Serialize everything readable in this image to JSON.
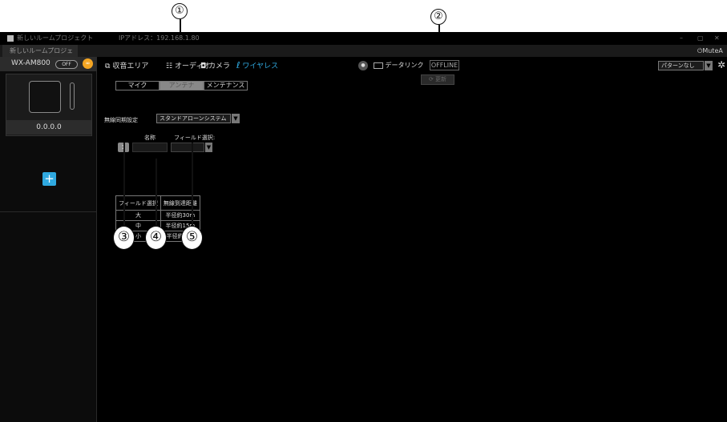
{
  "callouts": [
    "①",
    "②",
    "③",
    "④",
    "⑤"
  ],
  "titlebar": {
    "project": "新しいルームプロジェクト",
    "ip": "IPアドレス：192.168.1.80",
    "min": "–",
    "max": "▢",
    "close": "✕"
  },
  "menubar": {
    "project_tab": "新しいルームプロジェ",
    "mute_label": "MuteA"
  },
  "sidebar": {
    "device_name": "WX-AM800",
    "off_label": "OFF",
    "badge": "∞",
    "device_ip": "0.0.0.0",
    "add_label": "+"
  },
  "tabs": [
    {
      "icon": "⧉",
      "label": "収音エリア"
    },
    {
      "icon": "☷",
      "label": "オーディオ"
    },
    {
      "icon": "◘",
      "label": "カメラ"
    },
    {
      "icon": "ℓ",
      "label": "ワイヤレス"
    }
  ],
  "toolbar": {
    "mic_icon": "●",
    "datalink_label": "データリンク",
    "offline_label": "OFFLINE",
    "refresh_label": "⟳ 更新",
    "pattern_label": "パターンなし",
    "gear": "✲"
  },
  "subtabs": [
    "マイク",
    "アンテナ",
    "メンテナンス"
  ],
  "sync": {
    "label": "無線同期設定",
    "value": "スタンドアローンシステム"
  },
  "row": {
    "name_header": "名称",
    "field_header": "フィールド選択:",
    "index": "1",
    "name_value": "",
    "field_value": ""
  },
  "field_table": {
    "headers": [
      "フィールド選択",
      "無線到達距離"
    ],
    "rows": [
      [
        "大",
        "半径約30m"
      ],
      [
        "中",
        "半径約15m"
      ],
      [
        "小",
        "半径約 8m"
      ]
    ]
  }
}
